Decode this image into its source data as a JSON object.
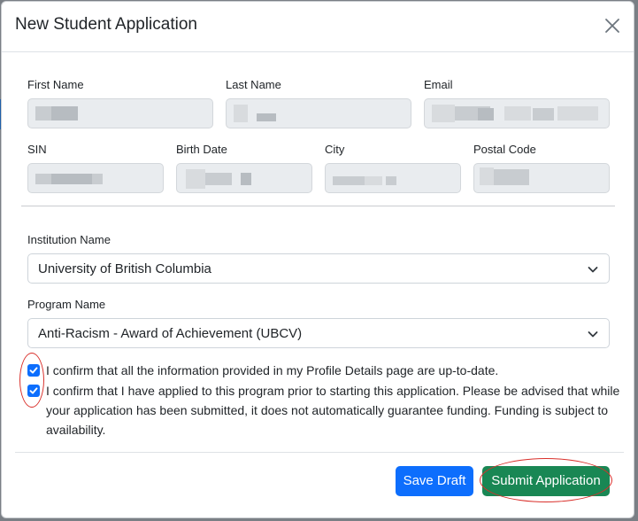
{
  "modal": {
    "title": "New Student Application"
  },
  "fields": {
    "first_name_label": "First Name",
    "last_name_label": "Last Name",
    "email_label": "Email",
    "sin_label": "SIN",
    "birth_date_label": "Birth Date",
    "city_label": "City",
    "postal_code_label": "Postal Code"
  },
  "institution": {
    "label": "Institution Name",
    "value": "University of British Columbia"
  },
  "program": {
    "label": "Program Name",
    "value": "Anti-Racism - Award of Achievement (UBCV)"
  },
  "checkboxes": [
    {
      "checked": true,
      "text": "I confirm that all the information provided in my Profile Details page are up-to-date."
    },
    {
      "checked": true,
      "text": "I confirm that I have applied to this program prior to starting this application. Please be advised that while your application has been submitted, it does not automatically guarantee funding. Funding is subject to availability."
    }
  ],
  "footer": {
    "save_draft_label": "Save Draft",
    "submit_label": "Submit Application"
  },
  "colors": {
    "primary": "#0d6efd",
    "success": "#198754",
    "annotation": "#d9302b"
  },
  "icons": {
    "close": "close-icon",
    "select_arrow": "chevron-down-icon",
    "checkmark": "checkmark-icon"
  }
}
